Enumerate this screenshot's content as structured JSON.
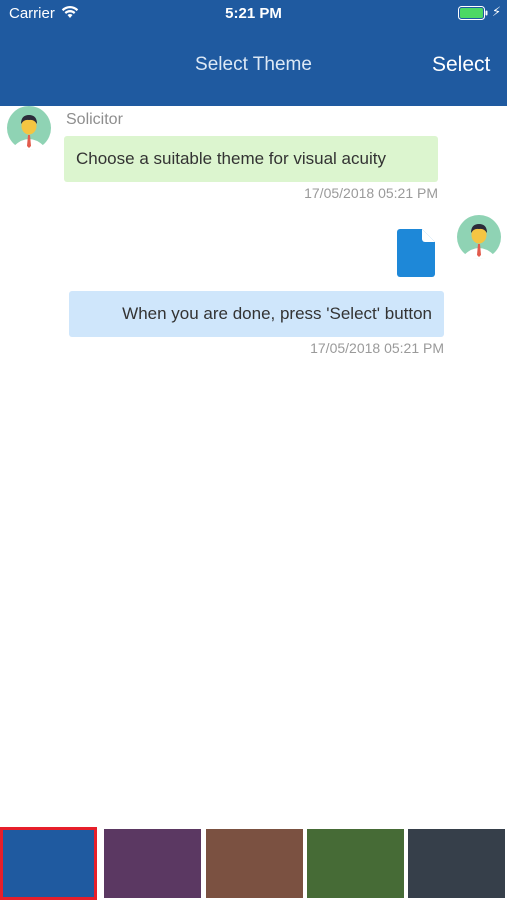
{
  "status_bar": {
    "carrier": "Carrier",
    "time": "5:21 PM"
  },
  "header": {
    "title": "Select Theme",
    "select_label": "Select"
  },
  "messages": [
    {
      "sender": "Solicitor",
      "text": "Choose a suitable theme for visual acuity",
      "timestamp": "17/05/2018 05:21 PM",
      "side": "left"
    },
    {
      "attachment": "document-icon",
      "text": "When you are done, press 'Select' button",
      "timestamp": "17/05/2018 05:21 PM",
      "side": "right"
    }
  ],
  "themes": [
    {
      "color": "#1f5aa0",
      "selected": true
    },
    {
      "color": "#5b3862",
      "selected": false
    },
    {
      "color": "#7b5141",
      "selected": false
    },
    {
      "color": "#466b36",
      "selected": false
    },
    {
      "color": "#363f4a",
      "selected": false
    }
  ],
  "colors": {
    "header": "#1f5aa0",
    "bubble_left": "#dcf5cf",
    "bubble_right": "#cfe6fb",
    "selection_border": "#e61f2a"
  }
}
